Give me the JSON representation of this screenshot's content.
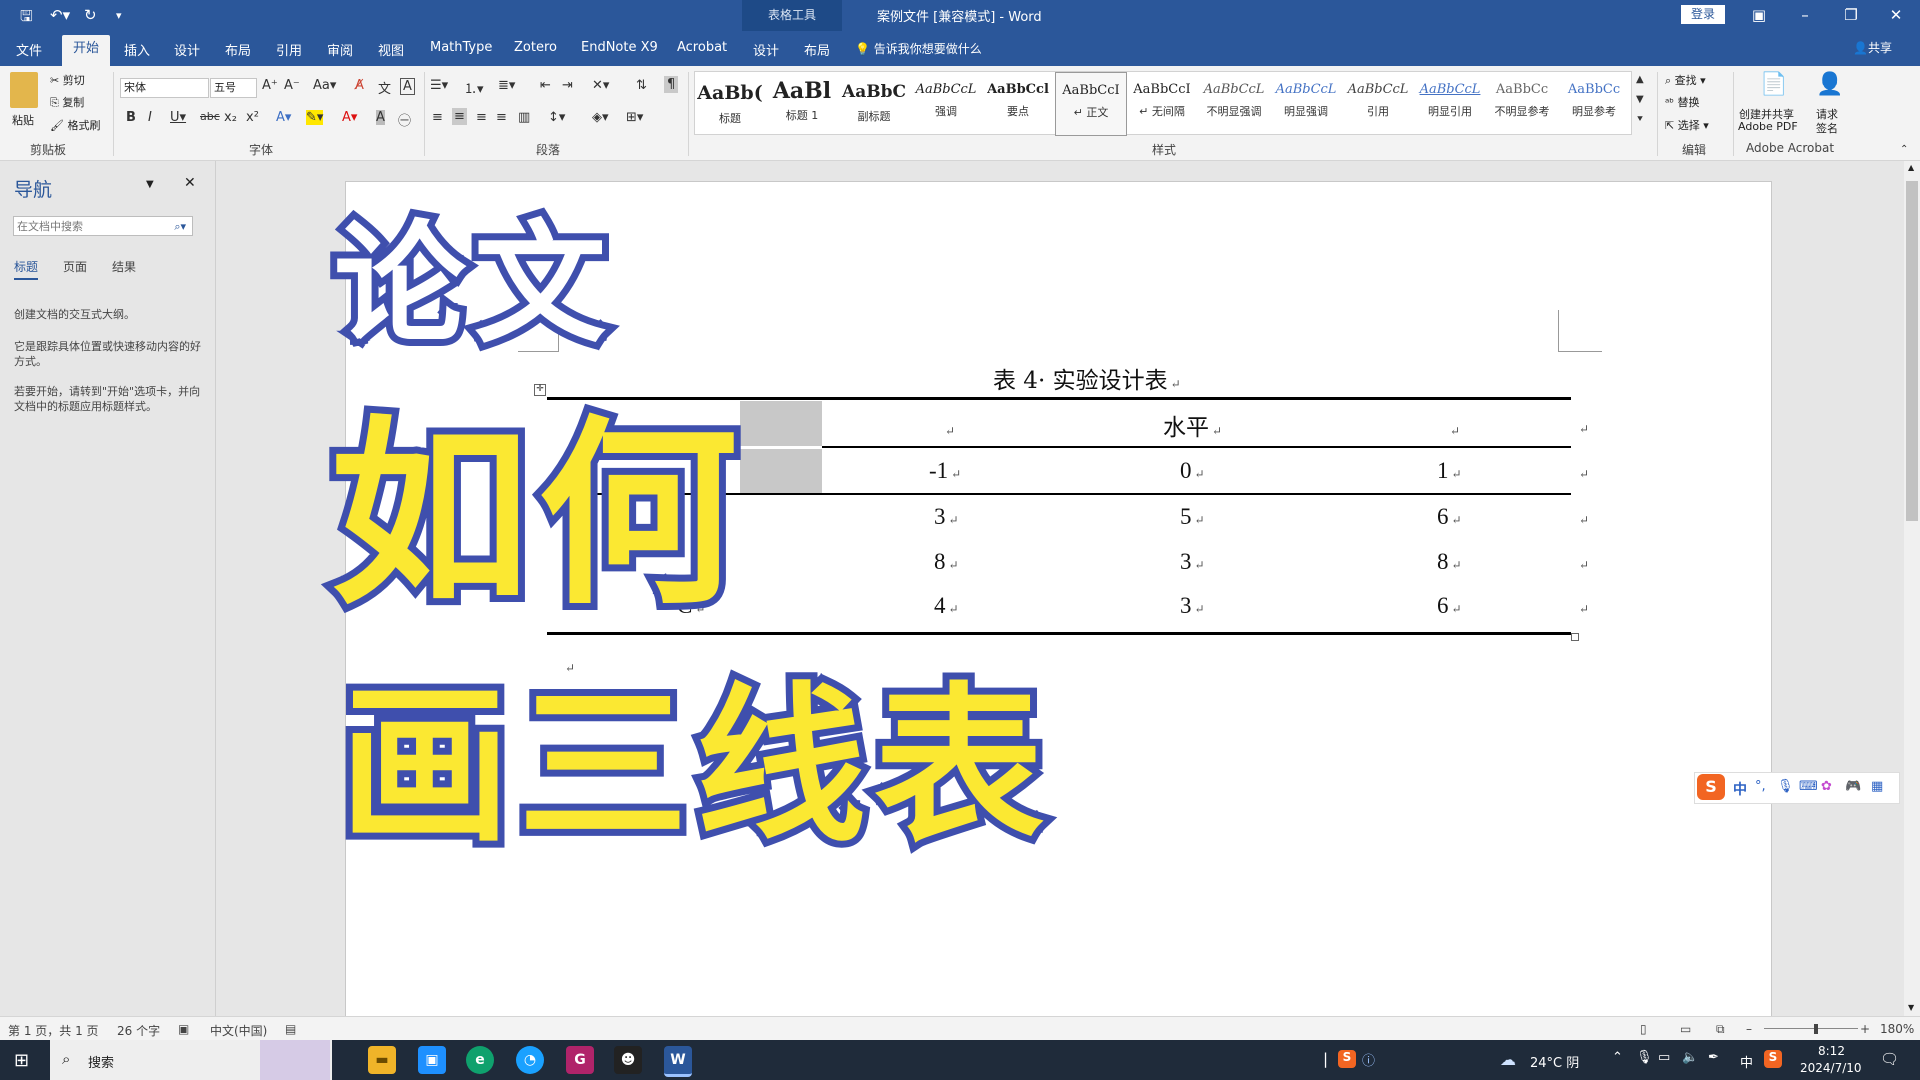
{
  "titlebar": {
    "context_group": "表格工具",
    "doc_title": "案例文件 [兼容模式] - Word",
    "login": "登录",
    "qat_save_icon": "save-icon",
    "qat_undo_icon": "undo-icon",
    "qat_redo_icon": "redo-icon"
  },
  "menu": {
    "tabs": [
      "文件",
      "开始",
      "插入",
      "设计",
      "布局",
      "引用",
      "审阅",
      "视图",
      "MathType",
      "Zotero",
      "EndNote X9",
      "Acrobat",
      "设计",
      "布局"
    ],
    "tell_me": "告诉我你想要做什么",
    "share": "共享"
  },
  "ribbon": {
    "clipboard": {
      "paste": "粘贴",
      "cut": "剪切",
      "copy": "复制",
      "format_painter": "格式刷",
      "label": "剪贴板"
    },
    "font": {
      "name": "宋体",
      "size": "五号",
      "label": "字体"
    },
    "paragraph": {
      "label": "段落"
    },
    "styles": {
      "label": "样式",
      "items": [
        {
          "sample": "AaBb(",
          "name": "标题"
        },
        {
          "sample": "AaBl",
          "name": "标题 1"
        },
        {
          "sample": "AaBbC",
          "name": "副标题"
        },
        {
          "sample": "AaBbCcL",
          "name": "强调"
        },
        {
          "sample": "AaBbCcl",
          "name": "要点"
        },
        {
          "sample": "AaBbCcI",
          "name": "↵ 正文"
        },
        {
          "sample": "AaBbCcI",
          "name": "↵ 无间隔"
        },
        {
          "sample": "AaBbCcL",
          "name": "不明显强调"
        },
        {
          "sample": "AaBbCcL",
          "name": "明显强调"
        },
        {
          "sample": "AaBbCcL",
          "name": "引用"
        },
        {
          "sample": "AaBbCcL",
          "name": "明显引用"
        },
        {
          "sample": "AaBbCc",
          "name": "不明显参考"
        },
        {
          "sample": "AaBbCc",
          "name": "明显参考"
        }
      ]
    },
    "editing": {
      "find": "查找",
      "replace": "替换",
      "select": "选择",
      "label": "编辑"
    },
    "acrobat": {
      "create_share": "创建并共享",
      "create_share2": "Adobe PDF",
      "request_sign": "请求",
      "request_sign2": "签名",
      "label": "Adobe Acrobat"
    }
  },
  "nav": {
    "title": "导航",
    "search_placeholder": "在文档中搜索",
    "tabs": [
      "标题",
      "页面",
      "结果"
    ],
    "text1": "创建文档的交互式大纲。",
    "text2": "它是跟踪具体位置或快速移动内容的好方式。",
    "text3": "若要开始，请转到\"开始\"选项卡，并向文档中的标题应用标题样式。"
  },
  "document": {
    "caption": "表 4· 实验设计表",
    "header_level": "水平",
    "levels": [
      "-1",
      "0",
      "1"
    ],
    "rows": [
      {
        "factor": "",
        "values": [
          "3",
          "5",
          "6"
        ]
      },
      {
        "factor": "",
        "values": [
          "8",
          "3",
          "8"
        ]
      },
      {
        "factor": "C",
        "values": [
          "4",
          "3",
          "6"
        ]
      }
    ],
    "mark": "↵"
  },
  "overlay": {
    "line1": "论文",
    "line2": "如何",
    "line3": "画三线表",
    "colors": {
      "fill_white": "#ffffff",
      "fill_yellow": "#fbe832",
      "stroke": "#3f4fad"
    }
  },
  "statusbar": {
    "page": "第 1 页，共 1 页",
    "words": "26 个字",
    "lang": "中文(中国)",
    "zoom": "180%"
  },
  "taskbar": {
    "search": "搜索",
    "weather": "24°C 阴",
    "ime": "中",
    "time": "8:12",
    "date": "2024/7/10"
  },
  "ime_bar": {
    "mode": "中"
  }
}
